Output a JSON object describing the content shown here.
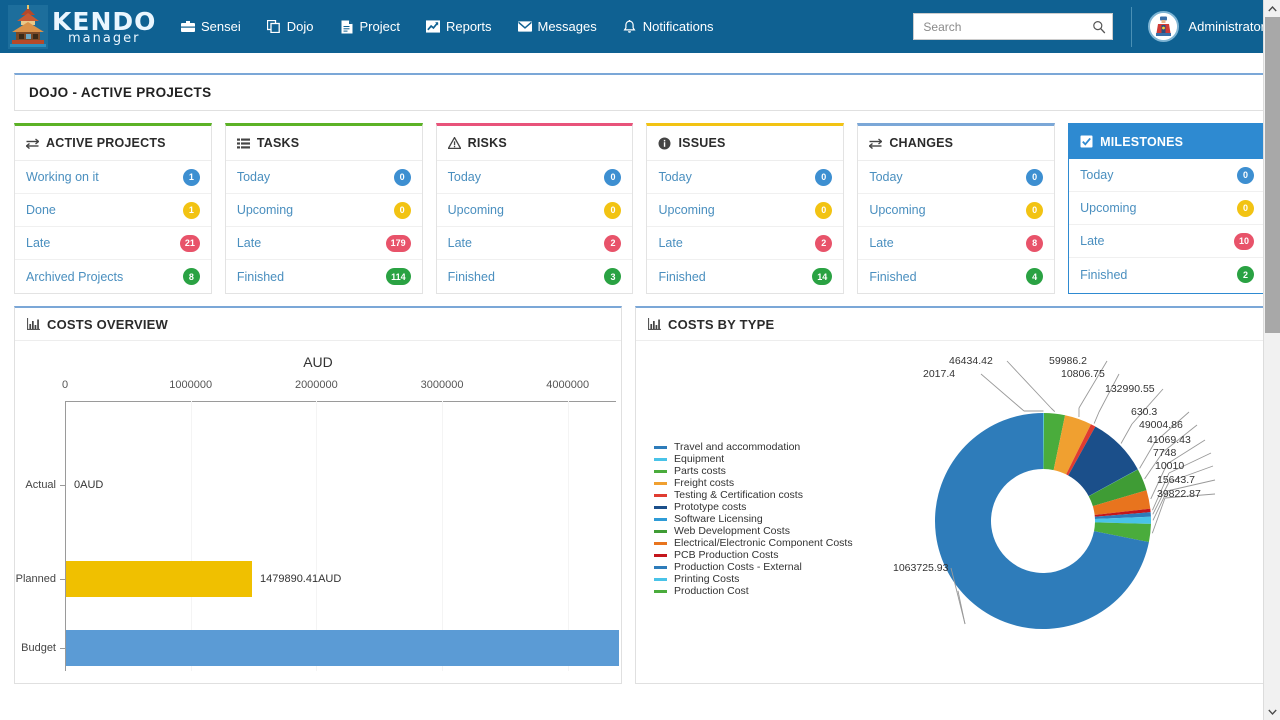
{
  "navbar": {
    "brand": {
      "name_top": "KENDO",
      "name_bottom": "manager",
      "logo_icon": "pagoda-logo-icon"
    },
    "links": [
      {
        "label": "Sensei",
        "icon": "briefcase-icon"
      },
      {
        "label": "Dojo",
        "icon": "copy-icon"
      },
      {
        "label": "Project",
        "icon": "file-icon"
      },
      {
        "label": "Reports",
        "icon": "chart-line-icon"
      },
      {
        "label": "Messages",
        "icon": "envelope-icon"
      },
      {
        "label": "Notifications",
        "icon": "bell-icon"
      }
    ],
    "search": {
      "placeholder": "Search",
      "value": "",
      "icon": "search-icon"
    },
    "user": {
      "name": "Administrator",
      "avatar_icon": "user-avatar-icon"
    }
  },
  "page": {
    "title": "DOJO - ACTIVE PROJECTS"
  },
  "colors": {
    "nav_bg": "#0f6192",
    "accent_blue": "#2e8ad1",
    "badge_blue": "#3d8fd1",
    "badge_yellow": "#f2c313",
    "badge_red": "#e8536a",
    "badge_green": "#2aa243",
    "border_green": "#5cb226",
    "border_pink": "#e8537a",
    "border_yellow": "#f2c313",
    "border_blue": "#7ba7d7",
    "bar_planned": "#f0c000",
    "bar_budget": "#5b9bd5"
  },
  "cards": [
    {
      "title": "ACTIVE PROJECTS",
      "icon": "exchange-icon",
      "top_color": "#5cb226",
      "selected": false,
      "rows": [
        {
          "label": "Working on it",
          "count": "1",
          "color": "#3d8fd1"
        },
        {
          "label": "Done",
          "count": "1",
          "color": "#f2c313"
        },
        {
          "label": "Late",
          "count": "21",
          "color": "#e8536a"
        },
        {
          "label": "Archived Projects",
          "count": "8",
          "color": "#2aa243"
        }
      ]
    },
    {
      "title": "TASKS",
      "icon": "tasks-icon",
      "top_color": "#5cb226",
      "selected": false,
      "rows": [
        {
          "label": "Today",
          "count": "0",
          "color": "#3d8fd1"
        },
        {
          "label": "Upcoming",
          "count": "0",
          "color": "#f2c313"
        },
        {
          "label": "Late",
          "count": "179",
          "color": "#e8536a"
        },
        {
          "label": "Finished",
          "count": "114",
          "color": "#2aa243"
        }
      ]
    },
    {
      "title": "RISKS",
      "icon": "warning-icon",
      "top_color": "#e8537a",
      "selected": false,
      "rows": [
        {
          "label": "Today",
          "count": "0",
          "color": "#3d8fd1"
        },
        {
          "label": "Upcoming",
          "count": "0",
          "color": "#f2c313"
        },
        {
          "label": "Late",
          "count": "2",
          "color": "#e8536a"
        },
        {
          "label": "Finished",
          "count": "3",
          "color": "#2aa243"
        }
      ]
    },
    {
      "title": "ISSUES",
      "icon": "info-icon",
      "top_color": "#f2c313",
      "selected": false,
      "rows": [
        {
          "label": "Today",
          "count": "0",
          "color": "#3d8fd1"
        },
        {
          "label": "Upcoming",
          "count": "0",
          "color": "#f2c313"
        },
        {
          "label": "Late",
          "count": "2",
          "color": "#e8536a"
        },
        {
          "label": "Finished",
          "count": "14",
          "color": "#2aa243"
        }
      ]
    },
    {
      "title": "CHANGES",
      "icon": "exchange-icon",
      "top_color": "#7ba7d7",
      "selected": false,
      "rows": [
        {
          "label": "Today",
          "count": "0",
          "color": "#3d8fd1"
        },
        {
          "label": "Upcoming",
          "count": "0",
          "color": "#f2c313"
        },
        {
          "label": "Late",
          "count": "8",
          "color": "#e8536a"
        },
        {
          "label": "Finished",
          "count": "4",
          "color": "#2aa243"
        }
      ]
    },
    {
      "title": "MILESTONES",
      "icon": "check-square-icon",
      "top_color": "#2e8ad1",
      "selected": true,
      "rows": [
        {
          "label": "Today",
          "count": "0",
          "color": "#3d8fd1"
        },
        {
          "label": "Upcoming",
          "count": "0",
          "color": "#f2c313"
        },
        {
          "label": "Late",
          "count": "10",
          "color": "#e8536a"
        },
        {
          "label": "Finished",
          "count": "2",
          "color": "#2aa243"
        }
      ]
    }
  ],
  "costs_overview": {
    "title": "COSTS OVERVIEW",
    "icon": "bar-chart-icon"
  },
  "costs_by_type": {
    "title": "COSTS BY TYPE",
    "icon": "bar-chart-icon"
  },
  "chart_data": [
    {
      "type": "bar",
      "orientation": "horizontal",
      "title": "AUD",
      "xlabel": "",
      "ylabel": "",
      "categories": [
        "Actual",
        "Planned",
        "Budget"
      ],
      "values": [
        0,
        1479890.41,
        4400000
      ],
      "value_labels": [
        "0AUD",
        "1479890.41AUD",
        ""
      ],
      "bar_colors": [
        "#f0c000",
        "#f0c000",
        "#5b9bd5"
      ],
      "xlim": [
        0,
        4400000
      ],
      "xticks": [
        0,
        1000000,
        2000000,
        3000000,
        4000000
      ],
      "xtick_labels": [
        "0",
        "1000000",
        "2000000",
        "3000000",
        "4000000"
      ],
      "grid": true,
      "legend": "none",
      "note": "Budget bar is clipped at the right edge of the panel"
    },
    {
      "type": "pie",
      "subtype": "donut",
      "title": "COSTS BY TYPE",
      "legend_position": "left",
      "labels": [
        "Travel and accommodation",
        "Equipment",
        "Parts costs",
        "Freight costs",
        "Testing & Certification costs",
        "Prototype costs",
        "Software Licensing",
        "Web Development Costs",
        "Electrical/Electronic Component Costs",
        "PCB Production Costs",
        "Production Costs - External",
        "Printing Costs",
        "Production Cost"
      ],
      "values": [
        1063725.93,
        2017.4,
        46434.42,
        59986.2,
        10806.75,
        132990.55,
        630.3,
        49004.86,
        41069.43,
        7748,
        10010,
        15643.7,
        39822.87
      ],
      "colors": [
        "#2e7cba",
        "#49c3e8",
        "#4aac3c",
        "#f0a030",
        "#e03c31",
        "#1b4f8a",
        "#2e9bd6",
        "#3f9c35",
        "#e8741e",
        "#c4161c",
        "#2e7cba",
        "#49c3e8",
        "#4aac3c"
      ],
      "data_labels": [
        "1063725.93",
        "2017.4",
        "46434.42",
        "59986.2",
        "10806.75",
        "132990.55",
        "630.3",
        "49004.86",
        "41069.43",
        "7748",
        "10010",
        "15643.7",
        "39822.87"
      ]
    }
  ],
  "scrollbar": {
    "up_icon": "chevron-up-icon",
    "down_icon": "chevron-down-icon"
  }
}
